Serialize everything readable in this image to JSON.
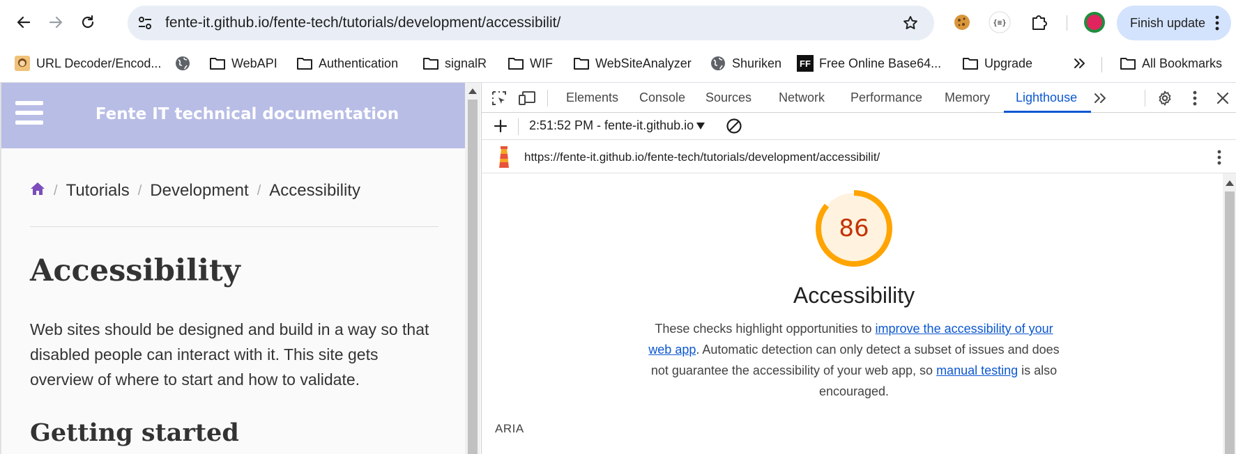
{
  "browser": {
    "url": "fente-it.github.io/fente-tech/tutorials/development/accessibilit/",
    "finish_update_label": "Finish update",
    "icons": {
      "back": "back-arrow-icon",
      "forward": "forward-arrow-icon",
      "reload": "reload-icon",
      "site_info": "tune-icon",
      "bookmark_star": "star-icon",
      "cookie_ext": "cookie-icon",
      "json_ext": "json-braces-icon",
      "extensions": "puzzle-icon",
      "profile": "profile-avatar-icon",
      "menu": "kebab-icon"
    }
  },
  "bookmarks": {
    "items": [
      {
        "label": "URL Decoder/Encod...",
        "icon": "favicon-icon"
      },
      {
        "label": "",
        "icon": "globe-icon"
      },
      {
        "label": "WebAPI",
        "icon": "folder-icon"
      },
      {
        "label": "Authentication",
        "icon": "folder-icon"
      },
      {
        "label": "signalR",
        "icon": "folder-icon"
      },
      {
        "label": "WIF",
        "icon": "folder-icon"
      },
      {
        "label": "WebSiteAnalyzer",
        "icon": "folder-icon"
      },
      {
        "label": "Shuriken",
        "icon": "globe-icon"
      },
      {
        "label": "Free Online Base64...",
        "icon": "ff-logo-icon"
      },
      {
        "label": "Upgrade",
        "icon": "folder-icon"
      }
    ],
    "overflow_icon": "chevron-double-right-icon",
    "all_bookmarks_label": "All Bookmarks"
  },
  "page": {
    "site_title": "Fente IT technical documentation",
    "breadcrumb": {
      "home_icon": "home-icon",
      "items": [
        "Tutorials",
        "Development",
        "Accessibility"
      ],
      "separator": "/"
    },
    "title": "Accessibility",
    "paragraph": "Web sites should be designed and build in a way so that disabled people can interact with it. This site gets overview of where to start and how to validate.",
    "subtitle": "Getting started"
  },
  "devtools": {
    "tabs": [
      "Elements",
      "Console",
      "Sources",
      "Network",
      "Performance",
      "Memory",
      "Lighthouse"
    ],
    "active_tab": "Lighthouse",
    "report_selector": "2:51:52 PM - fente-it.github.io",
    "report_url": "https://fente-it.github.io/fente-tech/tutorials/development/accessibilit/",
    "lighthouse": {
      "score": "86",
      "score_fraction": 0.86,
      "score_color": "#c33300",
      "gauge_color": "#ffa400",
      "gauge_fill": "#fff3e0",
      "category_title": "Accessibility",
      "description_part1": "These checks highlight opportunities to ",
      "description_link1": "improve the accessibility of your web app",
      "description_part2": ". Automatic detection can only detect a subset of issues and does not guarantee the accessibility of your web app, so ",
      "description_link2": "manual testing",
      "description_part3": " is also encouraged.",
      "group_label": "ARIA"
    }
  },
  "colors": {
    "header_bg": "#b8bde6",
    "omnibox_bg": "#e9eef6",
    "finish_update_bg": "#d3e3fd",
    "devtools_accent": "#0b57d0"
  }
}
